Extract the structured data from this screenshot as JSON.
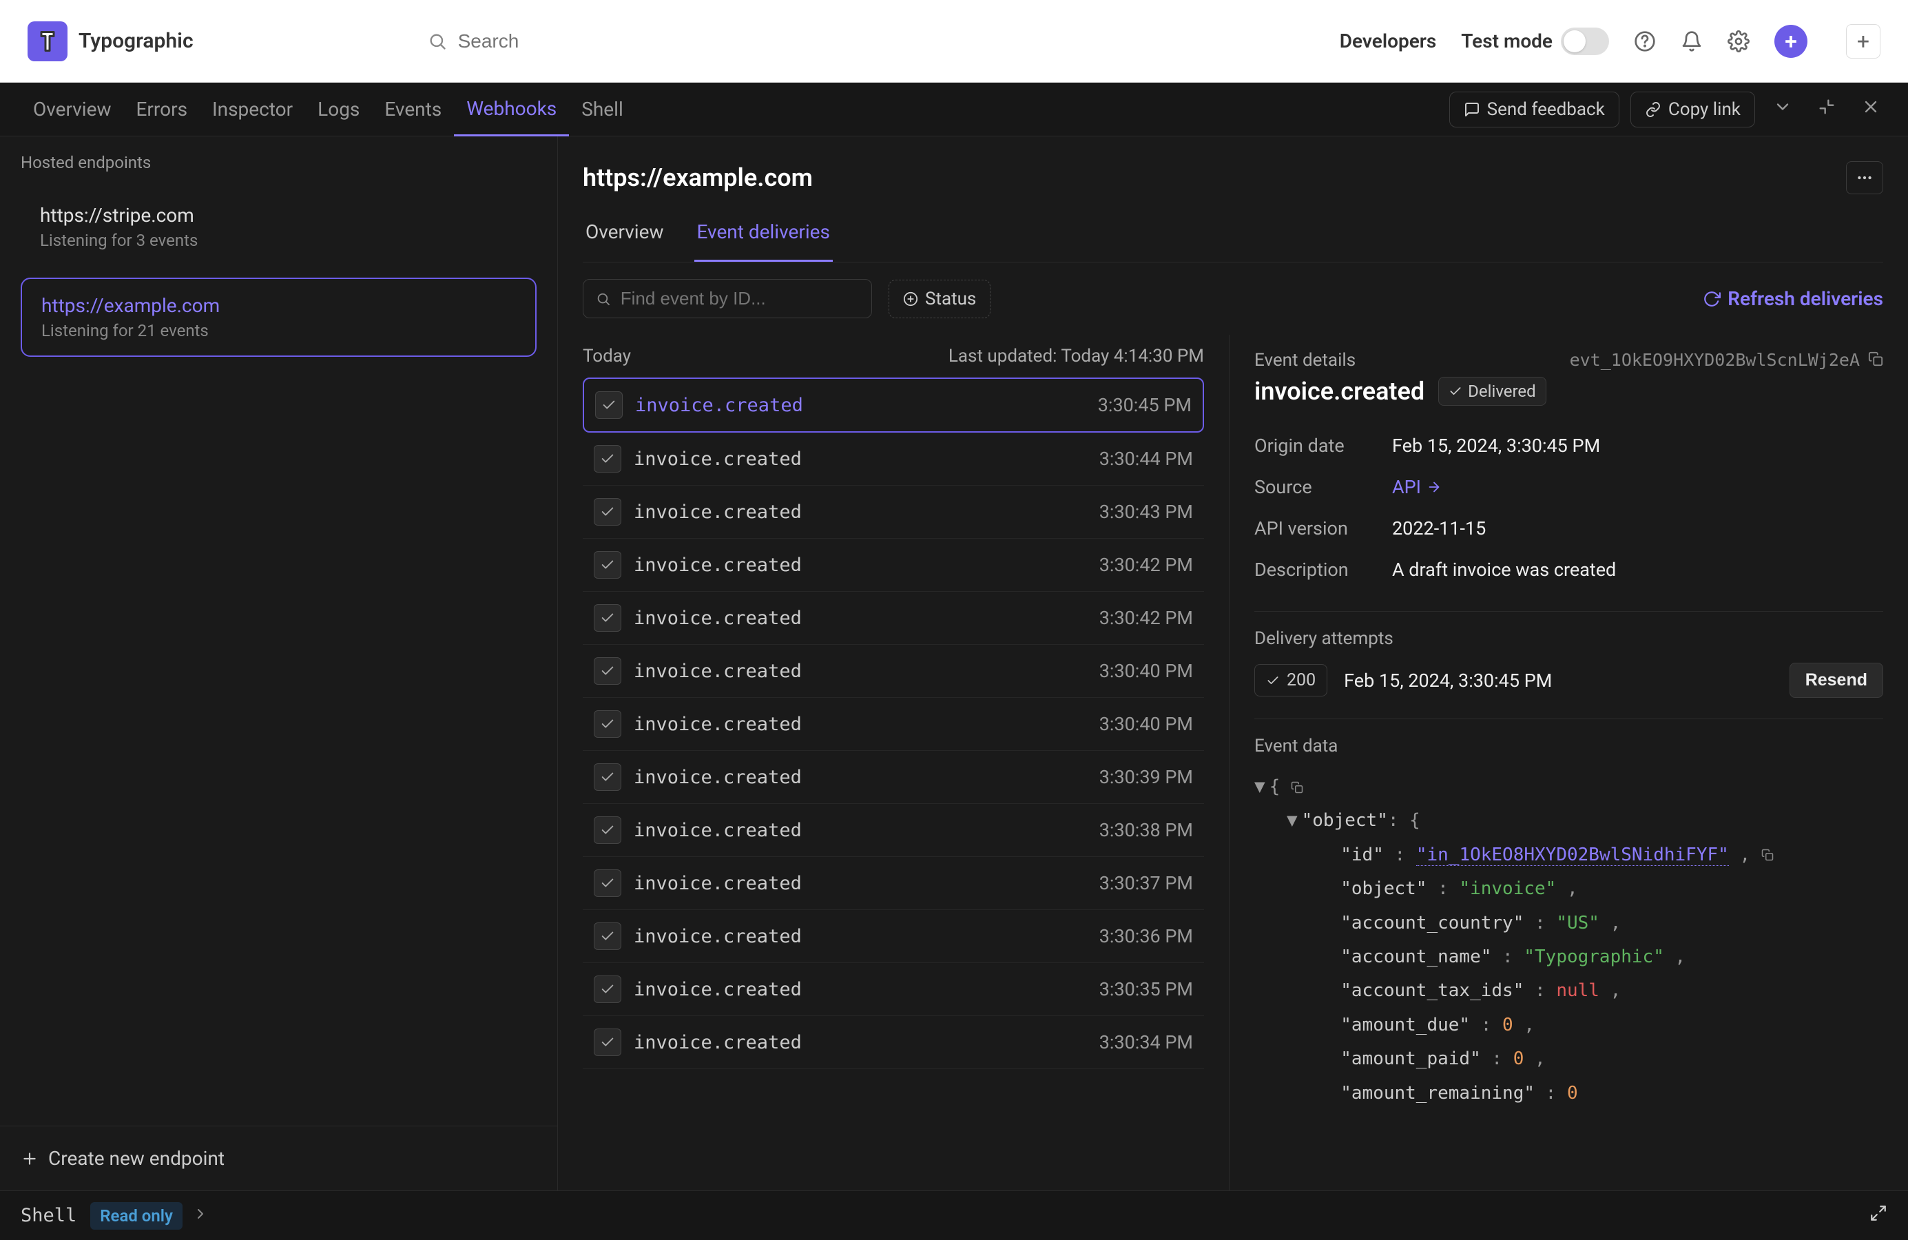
{
  "app": {
    "name": "Typographic"
  },
  "search": {
    "placeholder": "Search"
  },
  "topnav": {
    "developers": "Developers",
    "test_mode": "Test mode"
  },
  "devnav": {
    "tabs": [
      "Overview",
      "Errors",
      "Inspector",
      "Logs",
      "Events",
      "Webhooks",
      "Shell"
    ],
    "active": "Webhooks",
    "send_feedback": "Send feedback",
    "copy_link": "Copy link"
  },
  "sidebar": {
    "header": "Hosted endpoints",
    "endpoints": [
      {
        "url": "https://stripe.com",
        "sub": "Listening for 3 events",
        "selected": false
      },
      {
        "url": "https://example.com",
        "sub": "Listening for 21 events",
        "selected": true
      }
    ],
    "create": "Create new endpoint"
  },
  "content": {
    "title": "https://example.com",
    "tabs": [
      "Overview",
      "Event deliveries"
    ],
    "active_tab": "Event deliveries"
  },
  "toolbar": {
    "search_placeholder": "Find event by ID...",
    "status": "Status",
    "refresh": "Refresh deliveries"
  },
  "events_header": {
    "today": "Today",
    "updated": "Last updated: Today 4:14:30 PM"
  },
  "events": [
    {
      "name": "invoice.created",
      "time": "3:30:45 PM",
      "selected": true
    },
    {
      "name": "invoice.created",
      "time": "3:30:44 PM"
    },
    {
      "name": "invoice.created",
      "time": "3:30:43 PM"
    },
    {
      "name": "invoice.created",
      "time": "3:30:42 PM"
    },
    {
      "name": "invoice.created",
      "time": "3:30:42 PM"
    },
    {
      "name": "invoice.created",
      "time": "3:30:40 PM"
    },
    {
      "name": "invoice.created",
      "time": "3:30:40 PM"
    },
    {
      "name": "invoice.created",
      "time": "3:30:39 PM"
    },
    {
      "name": "invoice.created",
      "time": "3:30:38 PM"
    },
    {
      "name": "invoice.created",
      "time": "3:30:37 PM"
    },
    {
      "name": "invoice.created",
      "time": "3:30:36 PM"
    },
    {
      "name": "invoice.created",
      "time": "3:30:35 PM"
    },
    {
      "name": "invoice.created",
      "time": "3:30:34 PM"
    }
  ],
  "details": {
    "label": "Event details",
    "event_id": "evt_1OkEO9HXYD02BwlScnLWj2eA",
    "title": "invoice.created",
    "delivered": "Delivered",
    "meta": {
      "origin_date_key": "Origin date",
      "origin_date_val": "Feb 15, 2024, 3:30:45 PM",
      "source_key": "Source",
      "source_val": "API",
      "api_version_key": "API version",
      "api_version_val": "2022-11-15",
      "description_key": "Description",
      "description_val": "A draft invoice was created"
    },
    "attempts_label": "Delivery attempts",
    "attempt": {
      "status": "200",
      "time": "Feb 15, 2024, 3:30:45 PM",
      "resend": "Resend"
    },
    "data_label": "Event data",
    "json": {
      "id": "in_1OkEO8HXYD02BwlSNidhiFYF",
      "object": "invoice",
      "account_country": "US",
      "account_name": "Typographic",
      "account_tax_ids": "null",
      "amount_due": "0",
      "amount_paid": "0",
      "amount_remaining": "0"
    }
  },
  "shell": {
    "label": "Shell",
    "ro": "Read only"
  }
}
